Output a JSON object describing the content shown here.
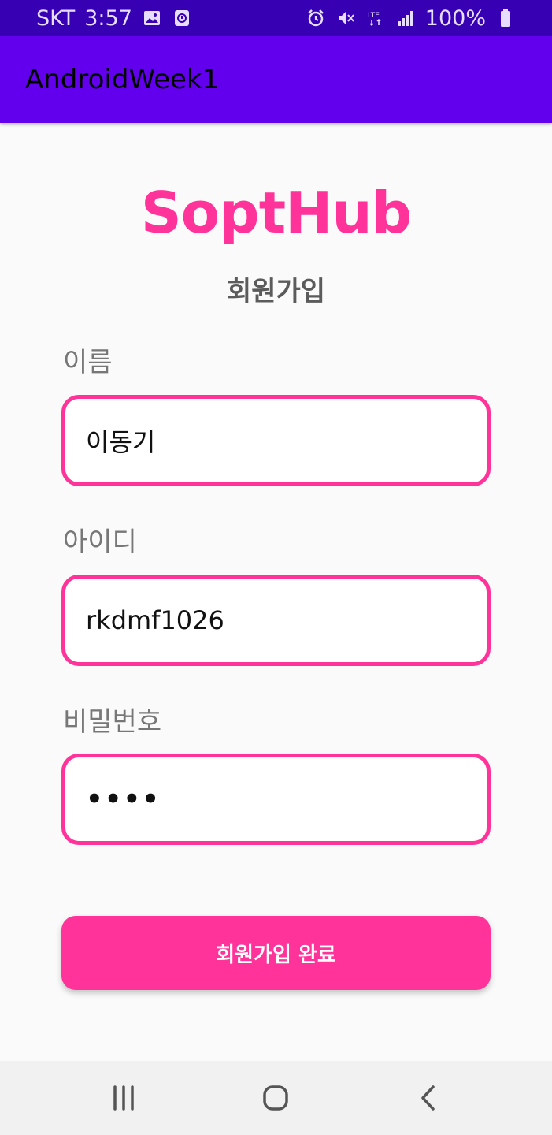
{
  "status_bar": {
    "carrier": "SKT",
    "time": "3:57",
    "battery": "100%",
    "network": "LTE",
    "icons": [
      "image-icon",
      "clock-app-icon",
      "alarm-icon",
      "mute-icon",
      "lte-icon",
      "signal-icon",
      "battery-icon"
    ]
  },
  "app_bar": {
    "title": "AndroidWeek1",
    "color": "#6200ee"
  },
  "brand": {
    "title": "SoptHub",
    "color": "#ff3399"
  },
  "subtitle": "회원가입",
  "form": {
    "name_label": "이름",
    "name_value": "이동기",
    "id_label": "아이디",
    "id_value": "rkdmf1026",
    "password_label": "비밀번호",
    "password_value": "••••"
  },
  "submit_label": "회원가입 완료",
  "nav_bar": {
    "icons": [
      "recent-apps-icon",
      "home-icon",
      "back-icon"
    ]
  }
}
